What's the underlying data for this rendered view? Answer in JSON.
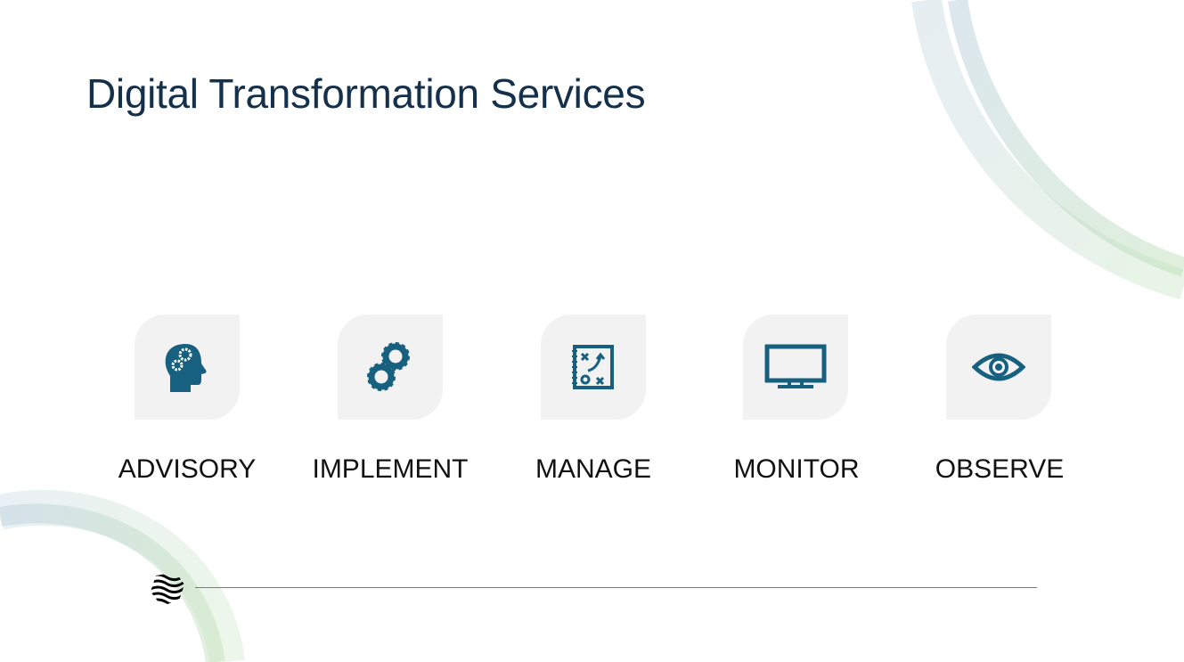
{
  "title": "Digital Transformation Services",
  "icon_color": "#17607f",
  "services": [
    {
      "label": "ADVISORY",
      "icon": "head-gears-icon"
    },
    {
      "label": "IMPLEMENT",
      "icon": "gears-icon"
    },
    {
      "label": "MANAGE",
      "icon": "strategy-board-icon"
    },
    {
      "label": "MONITOR",
      "icon": "monitor-icon"
    },
    {
      "label": "OBSERVE",
      "icon": "eye-icon"
    }
  ]
}
